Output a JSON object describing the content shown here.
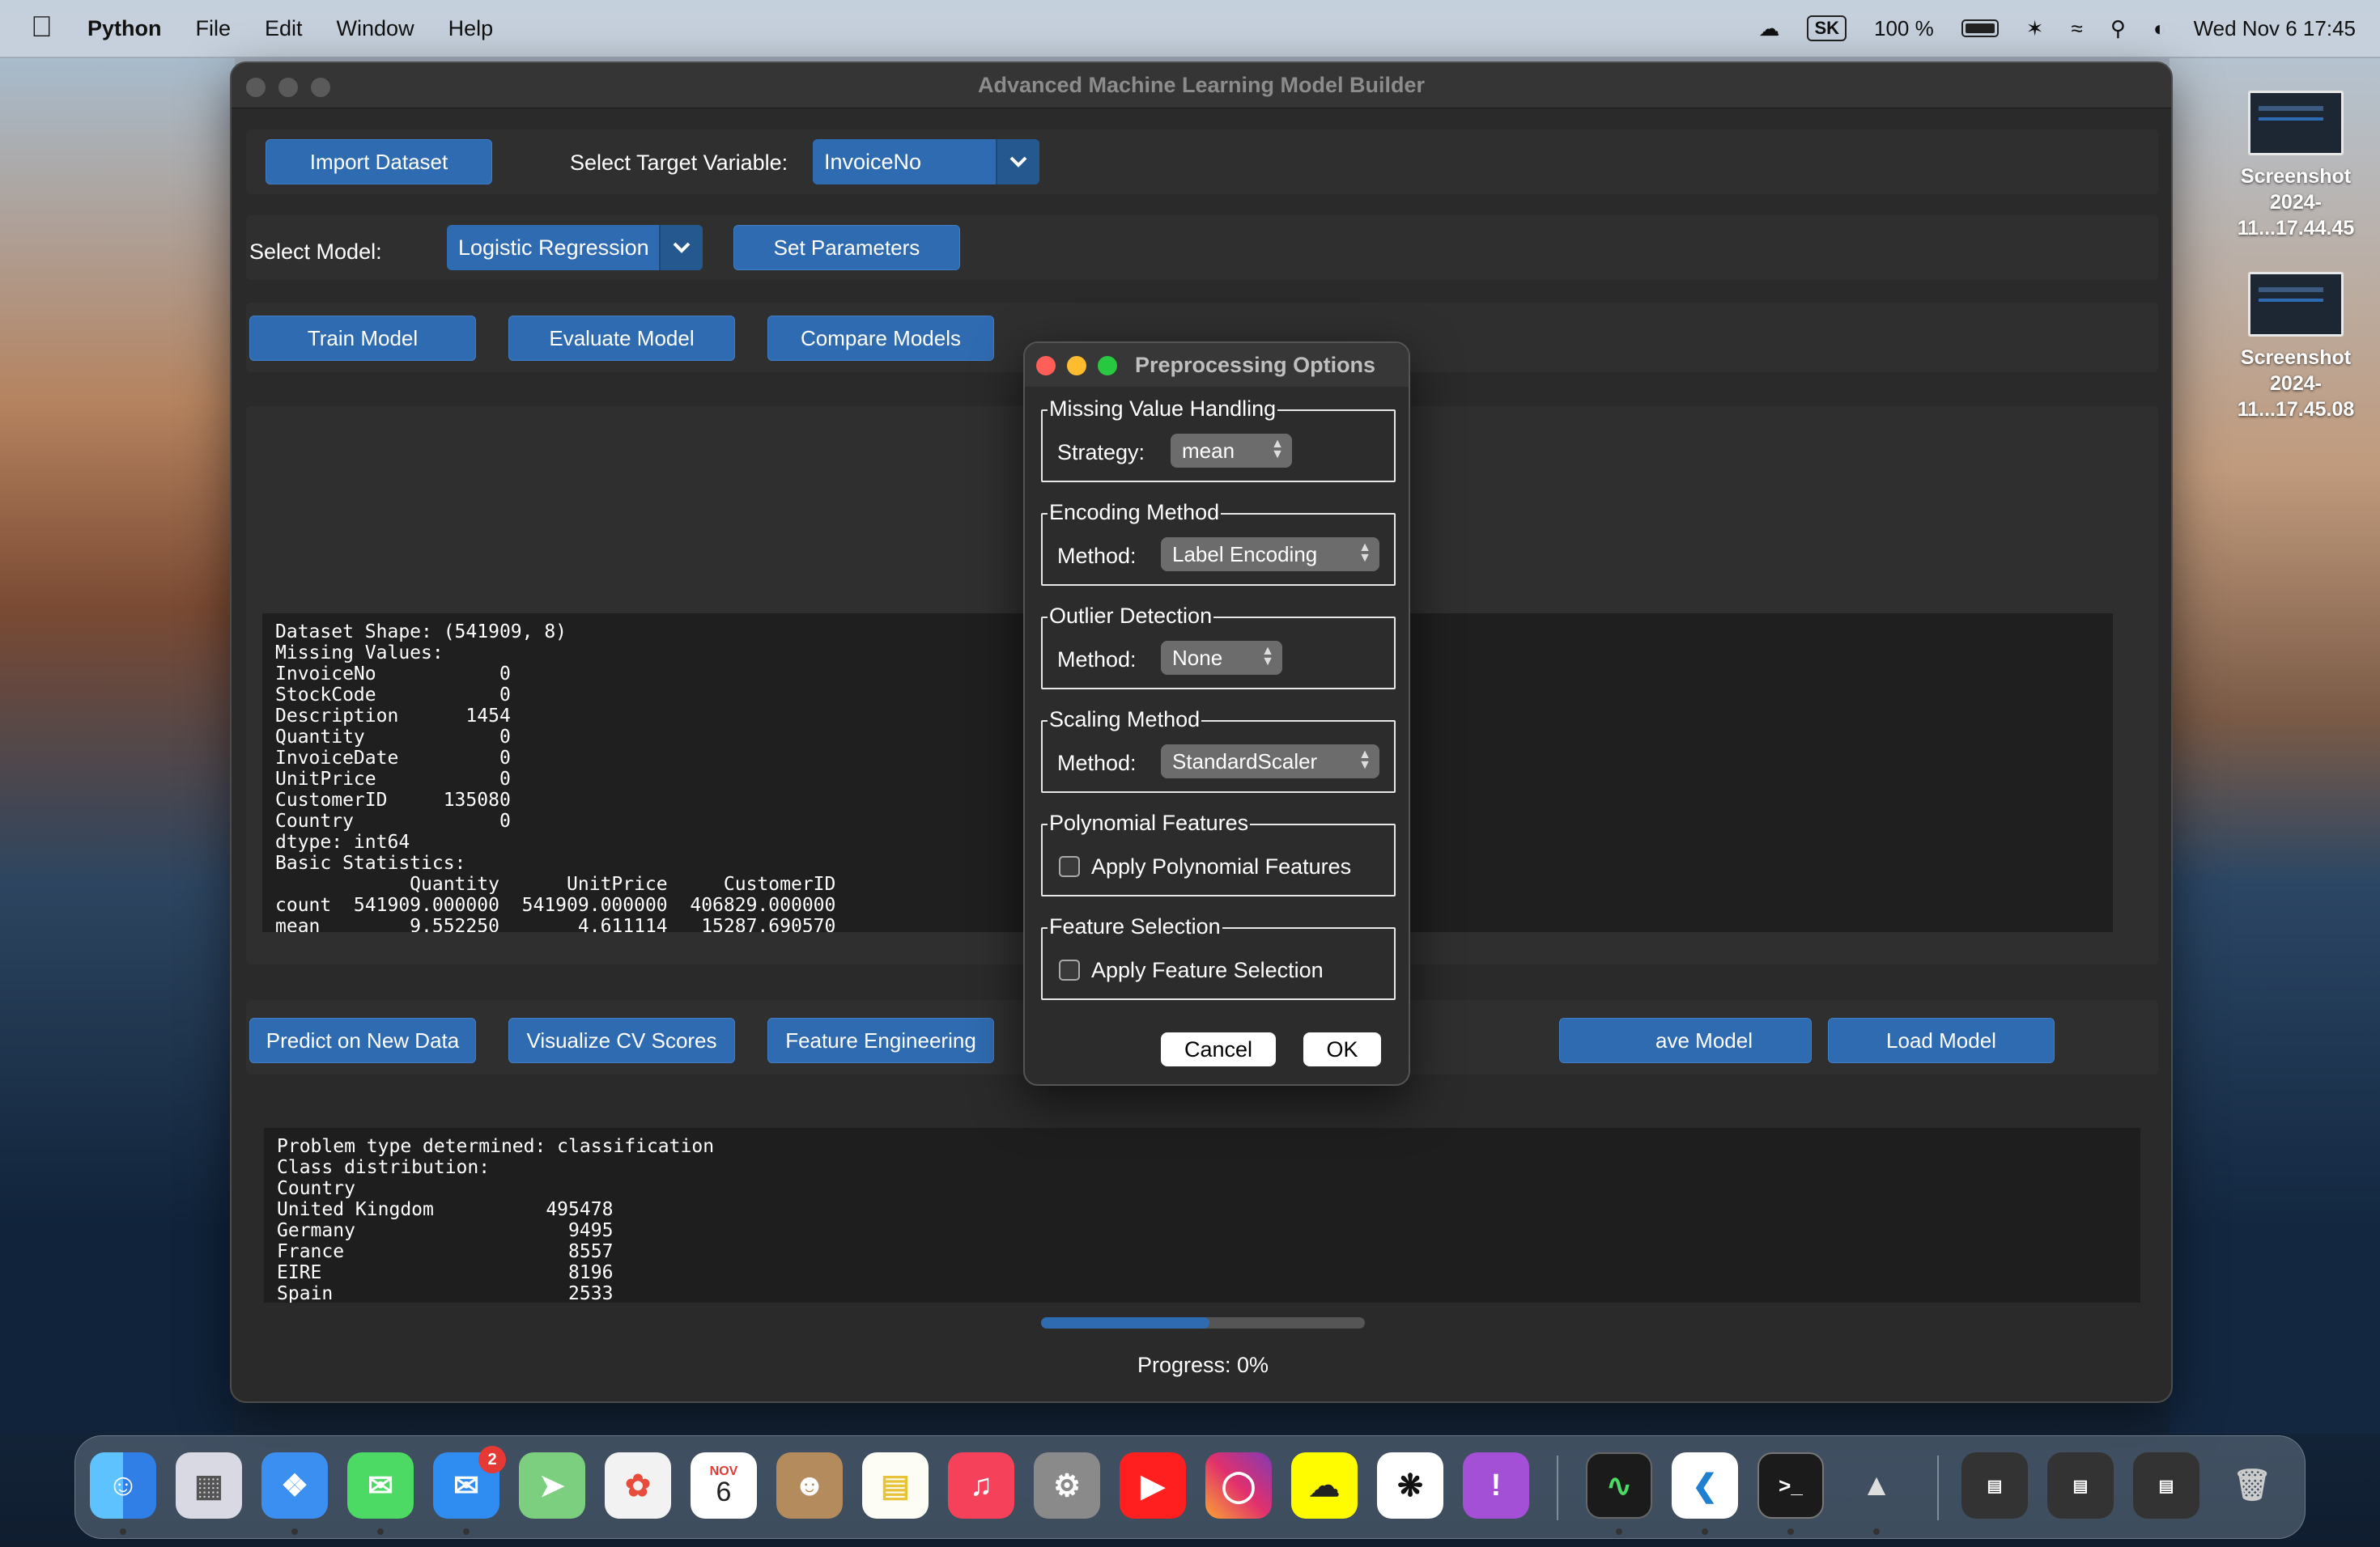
{
  "menubar": {
    "app_name": "Python",
    "menus": [
      "File",
      "Edit",
      "Window",
      "Help"
    ],
    "keyboard": "SK",
    "battery": "100 %",
    "datetime": "Wed Nov 6  17:45"
  },
  "window": {
    "title": "Advanced Machine Learning Model Builder",
    "import_button": "Import Dataset",
    "target_label": "Select Target Variable:",
    "target_value": "InvoiceNo",
    "model_label": "Select Model:",
    "model_value": "Logistic Regression",
    "set_params_button": "Set Parameters",
    "train_button": "Train Model",
    "evaluate_button": "Evaluate Model",
    "compare_button": "Compare Models",
    "predict_button": "Predict on New Data",
    "visualize_button": "Visualize CV Scores",
    "feature_eng_button": "Feature Engineering",
    "save_button_partial": "ave Model",
    "load_button": "Load Model",
    "console_top": "Dataset Shape: (541909, 8)\nMissing Values:\nInvoiceNo           0\nStockCode           0\nDescription      1454\nQuantity            0\nInvoiceDate         0\nUnitPrice           0\nCustomerID     135080\nCountry             0\ndtype: int64\nBasic Statistics:\n            Quantity      UnitPrice     CustomerID\ncount  541909.000000  541909.000000  406829.000000\nmean        9.552250       4.611114   15287.690570",
    "console_bottom": "Problem type determined: classification\nClass distribution:\nCountry\nUnited Kingdom          495478\nGermany                   9495\nFrance                    8557\nEIRE                      8196\nSpain                     2533",
    "progress_label": "Progress: 0%",
    "progress_fill": 0.52
  },
  "dialog": {
    "title": "Preprocessing Options",
    "missing": {
      "group": "Missing Value Handling",
      "label": "Strategy:",
      "value": "mean"
    },
    "encoding": {
      "group": "Encoding Method",
      "label": "Method:",
      "value": "Label Encoding"
    },
    "outlier": {
      "group": "Outlier Detection",
      "label": "Method:",
      "value": "None"
    },
    "scaling": {
      "group": "Scaling Method",
      "label": "Method:",
      "value": "StandardScaler"
    },
    "poly": {
      "group": "Polynomial Features",
      "checkbox": "Apply Polynomial Features"
    },
    "featsel": {
      "group": "Feature Selection",
      "checkbox": "Apply Feature Selection"
    },
    "cancel": "Cancel",
    "ok": "OK"
  },
  "desktop": {
    "files": [
      {
        "name_line1": "Screenshot",
        "name_line2": "2024-11...17.44.45"
      },
      {
        "name_line1": "Screenshot",
        "name_line2": "2024-11...17.45.08"
      }
    ]
  },
  "dock": {
    "calendar_month": "NOV",
    "calendar_day": "6",
    "mail_badge": "2",
    "icons": [
      "finder-icon",
      "launchpad-icon",
      "safari-icon",
      "messages-icon",
      "mail-icon",
      "maps-icon",
      "photos-icon",
      "calendar-icon",
      "contacts-icon",
      "notes-icon",
      "music-icon",
      "system-settings-icon",
      "youtube-icon",
      "instagram-icon",
      "snapchat-icon",
      "chatgpt-icon",
      "feedback-icon",
      "activity-monitor-icon",
      "vscode-icon",
      "terminal-icon",
      "rocket-icon",
      "trash-icon"
    ]
  }
}
